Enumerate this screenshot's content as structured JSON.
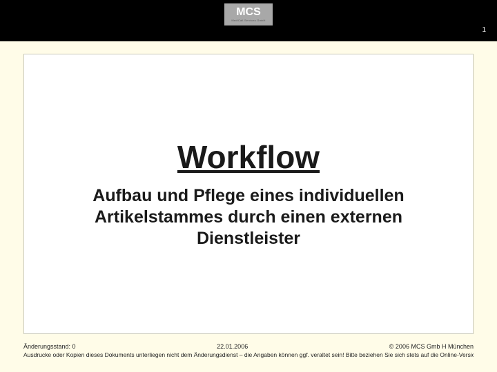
{
  "header": {
    "logo_main": "MCS",
    "logo_sub": "MediCall-Services GmbH",
    "page_number": "1"
  },
  "content": {
    "title": "Workflow",
    "subtitle": "Aufbau und Pflege eines individuellen Artikelstammes durch einen externen Dienstleister"
  },
  "footer": {
    "revision": "Änderungsstand: 0",
    "date": "22.01.2006",
    "copyright": "© 2006 MCS Gmb H München",
    "disclaimer": "Ausdrucke oder Kopien dieses Dokuments unterliegen nicht dem Änderungsdienst – die Angaben können ggf. veraltet sein! Bitte beziehen Sie sich stets auf die Online-Version."
  }
}
